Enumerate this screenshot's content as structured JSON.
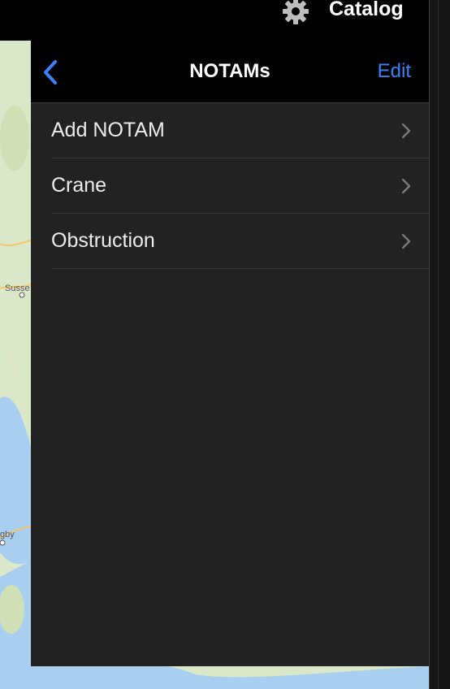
{
  "header": {
    "settings_icon": "gear-icon",
    "catalog_label": "Catalog"
  },
  "map": {
    "labels": [
      "Susse",
      "gby"
    ]
  },
  "nav": {
    "back_icon": "chevron-left-icon",
    "title": "NOTAMs",
    "edit_label": "Edit"
  },
  "list": {
    "items": [
      {
        "label": "Add NOTAM",
        "icon": "chevron-right-icon"
      },
      {
        "label": "Crane",
        "icon": "chevron-right-icon"
      },
      {
        "label": "Obstruction",
        "icon": "chevron-right-icon"
      }
    ]
  },
  "colors": {
    "accent": "#3b82f6",
    "panel_bg": "#222222",
    "nav_bg": "#000000",
    "water": "#a9cff0",
    "land": "#dbe7c9"
  }
}
